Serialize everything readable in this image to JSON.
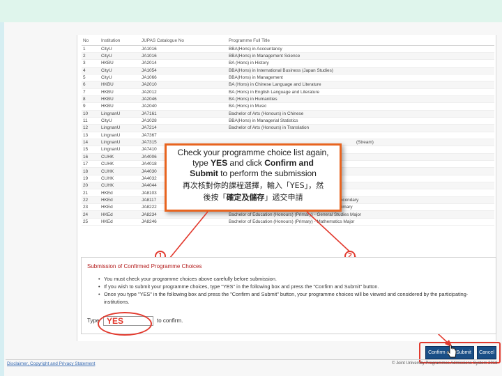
{
  "table": {
    "headers": [
      "No",
      "Institution",
      "JUPAS Catalogue No",
      "Programme Full Title"
    ],
    "rows": [
      [
        "1",
        "CityU",
        "JA1016",
        "BBA(Hons) in Accountancy"
      ],
      [
        "2",
        "CityU",
        "JA1016",
        "BBA(Hons) in Management Science"
      ],
      [
        "3",
        "HKBU",
        "JA2014",
        "BA (Hons) in History"
      ],
      [
        "4",
        "CityU",
        "JA1054",
        "BBA(Hons) in International Business (Japan Studies)"
      ],
      [
        "5",
        "CityU",
        "JA1066",
        "BBA(Hons) in Management"
      ],
      [
        "6",
        "HKBU",
        "JA2010",
        "BA (Hons) in Chinese Language and Literature"
      ],
      [
        "7",
        "HKBU",
        "JA2012",
        "BA (Hons) in English Language and Literature"
      ],
      [
        "8",
        "HKBU",
        "JA2046",
        "BA (Hons) in Humanities"
      ],
      [
        "9",
        "HKBU",
        "JA2040",
        "BA (Hons) in Music"
      ],
      [
        "10",
        "LingnanU",
        "JA7161",
        "Bachelor of Arts (Honours) in Chinese"
      ],
      [
        "11",
        "CityU",
        "JA1028",
        "BBA(Hons) in Managerial Statistics"
      ],
      [
        "12",
        "LingnanU",
        "JA7214",
        "Bachelor of Arts (Honours) in Translation"
      ],
      [
        "13",
        "LingnanU",
        "JA7367",
        ""
      ],
      [
        "14",
        "LingnanU",
        "JA7315",
        ""
      ],
      [
        "15",
        "LingnanU",
        "JA7410",
        ""
      ],
      [
        "16",
        "CUHK",
        "JA4006",
        ""
      ],
      [
        "17",
        "CUHK",
        "JA4018",
        ""
      ],
      [
        "18",
        "CUHK",
        "JA4030",
        ""
      ],
      [
        "19",
        "CUHK",
        "JA4032",
        ""
      ],
      [
        "20",
        "CUHK",
        "JA4044",
        ""
      ],
      [
        "21",
        "HKEd",
        "JA8103",
        ""
      ],
      [
        "22",
        "HKEd",
        "JA8117",
        "Bachelor of Education (Honours) (English Language) - Secondary"
      ],
      [
        "23",
        "HKEd",
        "JA8222",
        "Bachelor of Education (Honours) (English Language) - Primary"
      ],
      [
        "24",
        "HKEd",
        "JA8234",
        "Bachelor of Education (Honours) (Primary) - General Studies Major"
      ],
      [
        "25",
        "HKEd",
        "JA8246",
        "Bachelor of Education (Honours) (Primary) - Mathematics Major"
      ]
    ],
    "row14_tail": "(Stream)"
  },
  "callout": {
    "line1": "Check your programme choice list again,",
    "line2_pre": "type ",
    "line2_yes": "YES",
    "line2_mid": " and click ",
    "line2_btn": "Confirm and",
    "line3_btn": "Submit",
    "line3_post": " to perform the submission",
    "zh1": "再次核對你的課程選擇，輸入「YES」，然",
    "zh2_pre": "後按「",
    "zh2_btn": "確定及儲存",
    "zh2_post": "」遞交申請"
  },
  "markers": {
    "one": "1",
    "two": "2"
  },
  "submission": {
    "title": "Submission of Confirmed Programme Choices",
    "bullets": [
      "You must check your programme choices above carefully before submission.",
      "If you wish to submit your programme choices, type \"YES\" in the following box and press the \"Confirm and Submit\" button.",
      "Once you type \"YES\" in the following box and press the \"Confirm and Submit\" button, your programme choices will be viewed and considered by the participating-institutions."
    ],
    "type_label": "Type",
    "input_value": "YES",
    "suffix": "to confirm."
  },
  "buttons": {
    "confirm": "Confirm and Submit",
    "cancel": "Cancel"
  },
  "footer": {
    "left": "Disclaimer, Copyright and Privacy Statement",
    "right": "© Joint University Programmes Admissions System 2018"
  },
  "colors": {
    "accent_red": "#e23a2e",
    "callout_border": "#e8641f",
    "button_blue": "#1a4e86",
    "link_blue": "#3d6fb5",
    "title_red": "#b31b1b"
  }
}
